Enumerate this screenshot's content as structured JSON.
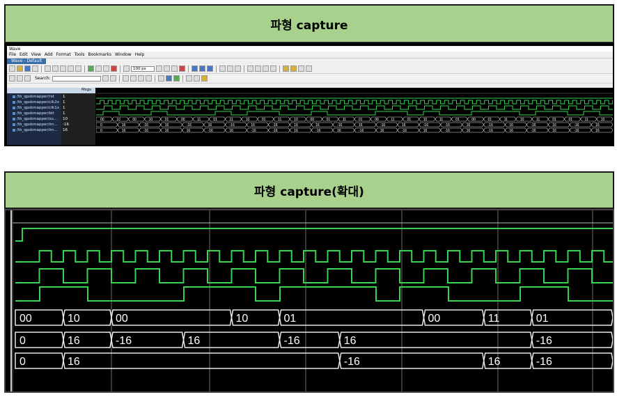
{
  "banners": {
    "top": "파형  capture",
    "bottom": "파형  capture(확대)"
  },
  "window": {
    "title": "Wave",
    "menu": [
      "File",
      "Edit",
      "View",
      "Add",
      "Format",
      "Tools",
      "Bookmarks",
      "Window",
      "Help"
    ],
    "tab": "Wave - Default",
    "search_label": "Search:",
    "time_value": "100 ps",
    "msgs_header": "Msgs"
  },
  "signals": [
    {
      "name": "/tb_qpskmapper/rst",
      "value": "1"
    },
    {
      "name": "/tb_qpskmapper/clk2x",
      "value": "1"
    },
    {
      "name": "/tb_qpskmapper/clk1x",
      "value": "1"
    },
    {
      "name": "/tb_qpskmapper/bit",
      "value": "1"
    },
    {
      "name": "/tb_qpskmapper/su...",
      "value": "10"
    },
    {
      "name": "/tb_qpskmapper/im...",
      "value": "-16"
    },
    {
      "name": "/tb_qpskmapper/im...",
      "value": "16"
    }
  ],
  "zoom_buses": {
    "sym": [
      {
        "start": 0,
        "label": "00"
      },
      {
        "start": 1,
        "label": "10"
      },
      {
        "start": 2,
        "label": "00"
      },
      {
        "start": 4.5,
        "label": "10"
      },
      {
        "start": 5.5,
        "label": "01"
      },
      {
        "start": 8.5,
        "label": "00"
      },
      {
        "start": 9.75,
        "label": "11"
      },
      {
        "start": 10.75,
        "label": "01"
      }
    ],
    "i": [
      {
        "start": 0,
        "label": "0"
      },
      {
        "start": 1,
        "label": "16"
      },
      {
        "start": 2,
        "label": "-16"
      },
      {
        "start": 3.5,
        "label": "16"
      },
      {
        "start": 5.5,
        "label": "-16"
      },
      {
        "start": 6.75,
        "label": "16"
      },
      {
        "start": 10.75,
        "label": "-16"
      }
    ],
    "q": [
      {
        "start": 0,
        "label": "0"
      },
      {
        "start": 1,
        "label": "16"
      },
      {
        "start": 6.75,
        "label": "-16"
      },
      {
        "start": 9.75,
        "label": "16"
      },
      {
        "start": 10.75,
        "label": "-16"
      }
    ]
  },
  "overview_buses": {
    "sym": [
      "00",
      "10",
      "00",
      "10",
      "01",
      "00",
      "11",
      "01",
      "11",
      "10",
      "01",
      "11",
      "10",
      "00",
      "01",
      "11",
      "01",
      "00",
      "11",
      "01",
      "10",
      "11",
      "01",
      "00",
      "01",
      "11",
      "10",
      "11",
      "01",
      "01",
      "11",
      "10"
    ],
    "i": [
      "0",
      "16",
      "-16",
      "16",
      "-16",
      "16",
      "-16",
      "16",
      "-16",
      "16",
      "16",
      "-16",
      "16",
      "-16",
      "16",
      "-16",
      "-16",
      "16",
      "-16",
      "16",
      "-16",
      "16",
      "-16",
      "16"
    ],
    "q": [
      "0",
      "16",
      "-16",
      "16",
      "16",
      "-16",
      "16",
      "-16",
      "-16",
      "16",
      "-16",
      "16",
      "-16",
      "16",
      "-16",
      "16",
      "-16",
      "16",
      "-16",
      "16",
      "-16",
      "16",
      "-16",
      "16"
    ]
  }
}
